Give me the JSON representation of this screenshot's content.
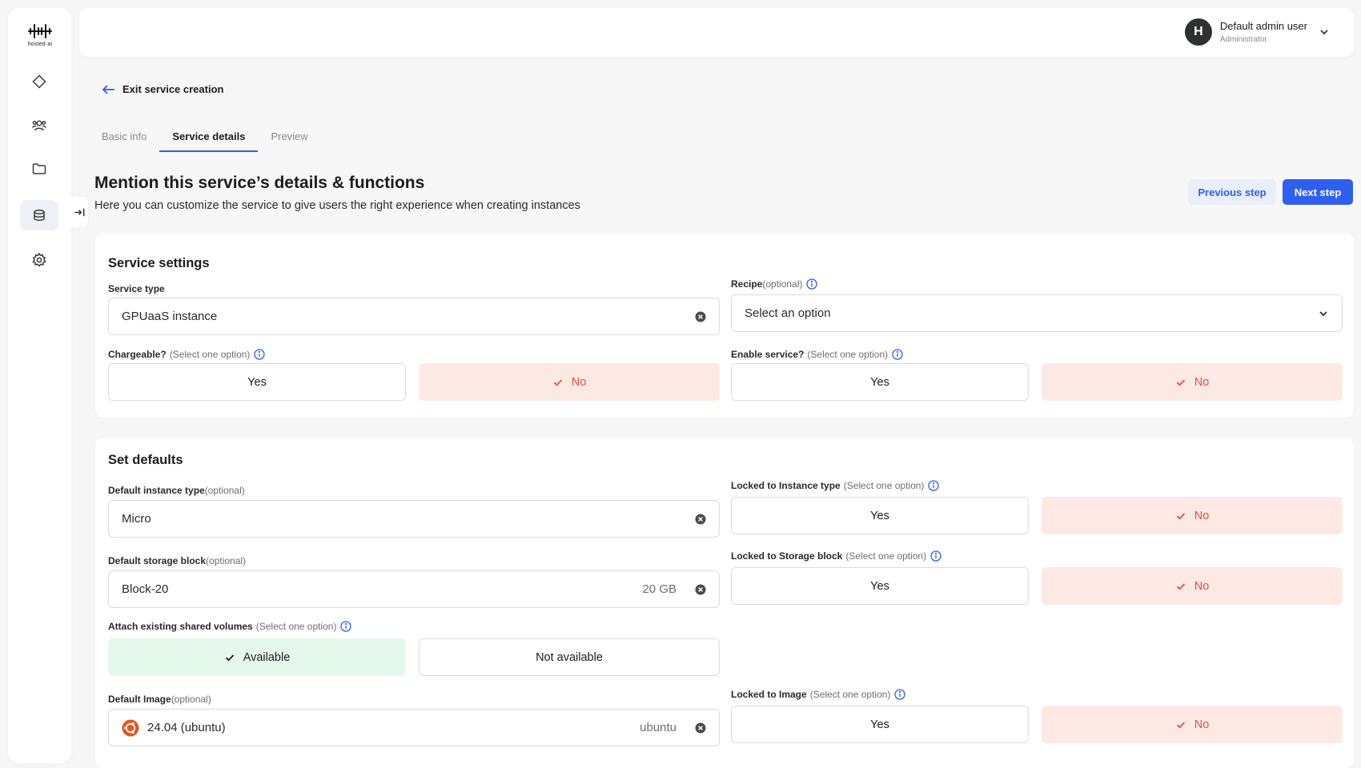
{
  "brand": {
    "logo_text": "hosted·ai"
  },
  "sidebar": {
    "items": [
      {
        "icon": "diamond-icon",
        "active": false
      },
      {
        "icon": "users-icon",
        "active": false
      },
      {
        "icon": "folder-icon",
        "active": false
      },
      {
        "icon": "services-icon",
        "active": true
      },
      {
        "icon": "gear-icon",
        "active": false
      }
    ]
  },
  "header": {
    "user_initial": "H",
    "user_name": "Default admin user",
    "user_role": "Administrator"
  },
  "exit_label": "Exit service creation",
  "tabs": [
    {
      "label": "Basic info",
      "active": false
    },
    {
      "label": "Service details",
      "active": true
    },
    {
      "label": "Preview",
      "active": false
    }
  ],
  "page": {
    "title": "Mention this service’s details & functions",
    "subtitle": "Here you can customize the service to give users the right experience when creating instances",
    "prev_label": "Previous step",
    "next_label": "Next step"
  },
  "service_settings": {
    "title": "Service settings",
    "service_type": {
      "label": "Service type",
      "value": "GPUaaS instance"
    },
    "recipe": {
      "label": "Recipe",
      "hint": "(optional)",
      "placeholder": "Select an option"
    },
    "chargeable": {
      "label": "Chargeable?",
      "hint": "(Select one option)",
      "yes": "Yes",
      "no": "No",
      "selected": "No"
    },
    "enable_service": {
      "label": "Enable service?",
      "hint": "(Select one option)",
      "yes": "Yes",
      "no": "No",
      "selected": "No"
    }
  },
  "defaults": {
    "title": "Set defaults",
    "instance_type": {
      "label": "Default instance type",
      "hint": "(optional)",
      "value": "Micro"
    },
    "locked_instance": {
      "label": "Locked to Instance type",
      "hint": "(Select one option)",
      "yes": "Yes",
      "no": "No",
      "selected": "No"
    },
    "storage_block": {
      "label": "Default storage block",
      "hint": "(optional)",
      "value": "Block-20",
      "size": "20 GB"
    },
    "locked_storage": {
      "label": "Locked to Storage block",
      "hint": "(Select one option)",
      "yes": "Yes",
      "no": "No",
      "selected": "No"
    },
    "shared_volumes": {
      "label": "Attach existing shared volumes",
      "hint": "(Select one option)",
      "available": "Available",
      "not_available": "Not available",
      "selected": "Available"
    },
    "image": {
      "label": "Default Image",
      "hint": "(optional)",
      "value": "24.04 (ubuntu)",
      "os": "ubuntu"
    },
    "locked_image": {
      "label": "Locked to Image",
      "hint": "(Select one option)",
      "yes": "Yes",
      "no": "No",
      "selected": "No"
    }
  },
  "colors": {
    "accent": "#2f5ff0",
    "selected_no_bg": "#fde9e4",
    "selected_no_text": "#e0533b",
    "selected_available_bg": "#e5f8ec",
    "ubuntu": "#e95420"
  }
}
